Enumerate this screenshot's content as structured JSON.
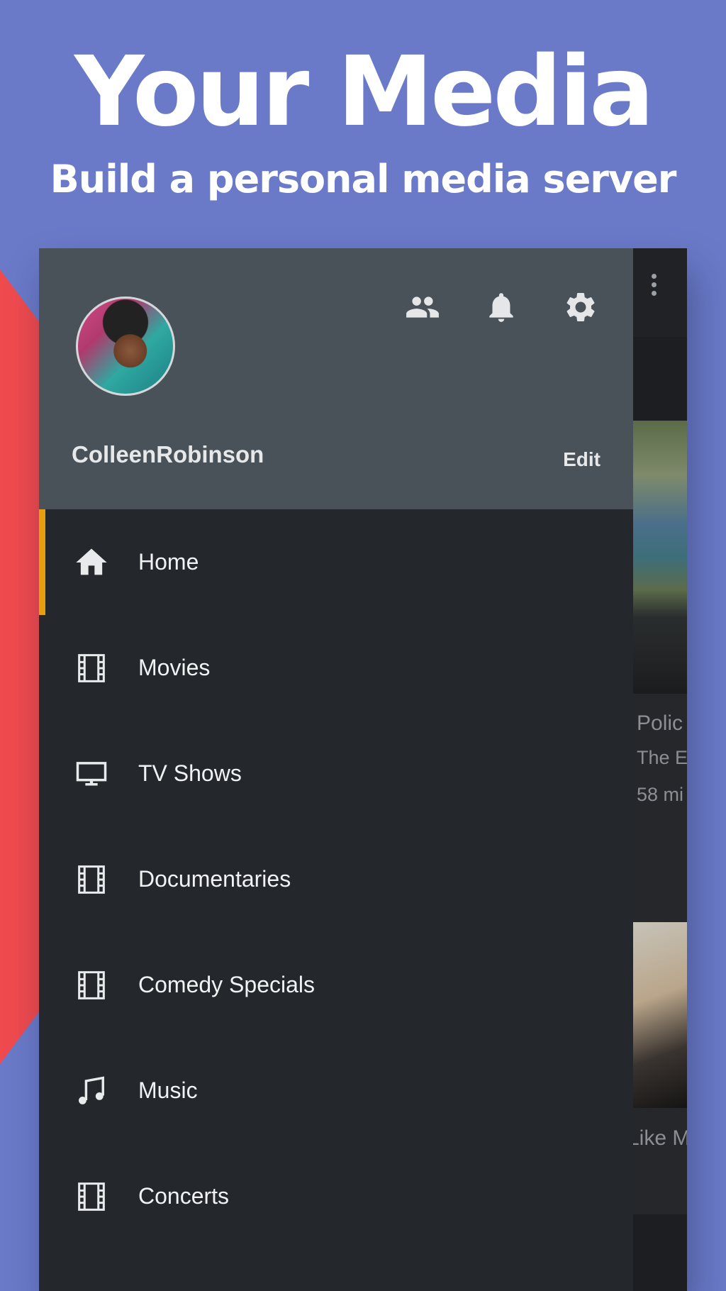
{
  "promo": {
    "headline": "Your Media",
    "subline": "Build a personal media server"
  },
  "colors": {
    "background": "#6a7ac8",
    "accent_red": "#ef4b4e",
    "drawer_bg": "#24272c",
    "header_bg": "#495259",
    "active_indicator": "#e5a00d"
  },
  "header": {
    "icons": [
      "users-icon",
      "bell-icon",
      "gear-icon"
    ],
    "username": "ColleenRobinson",
    "edit_label": "Edit"
  },
  "menu": {
    "items": [
      {
        "label": "Home",
        "icon": "home-icon",
        "active": true
      },
      {
        "label": "Movies",
        "icon": "film-icon"
      },
      {
        "label": "TV Shows",
        "icon": "tv-icon"
      },
      {
        "label": "Documentaries",
        "icon": "film-icon"
      },
      {
        "label": "Comedy Specials",
        "icon": "film-icon"
      },
      {
        "label": "Music",
        "icon": "music-note-icon"
      },
      {
        "label": "Concerts",
        "icon": "film-icon"
      }
    ]
  },
  "background_content": {
    "item1_title": "Polic",
    "item1_subtitle": "The E",
    "item1_duration": "58 mi",
    "item2_title": "Like M"
  }
}
